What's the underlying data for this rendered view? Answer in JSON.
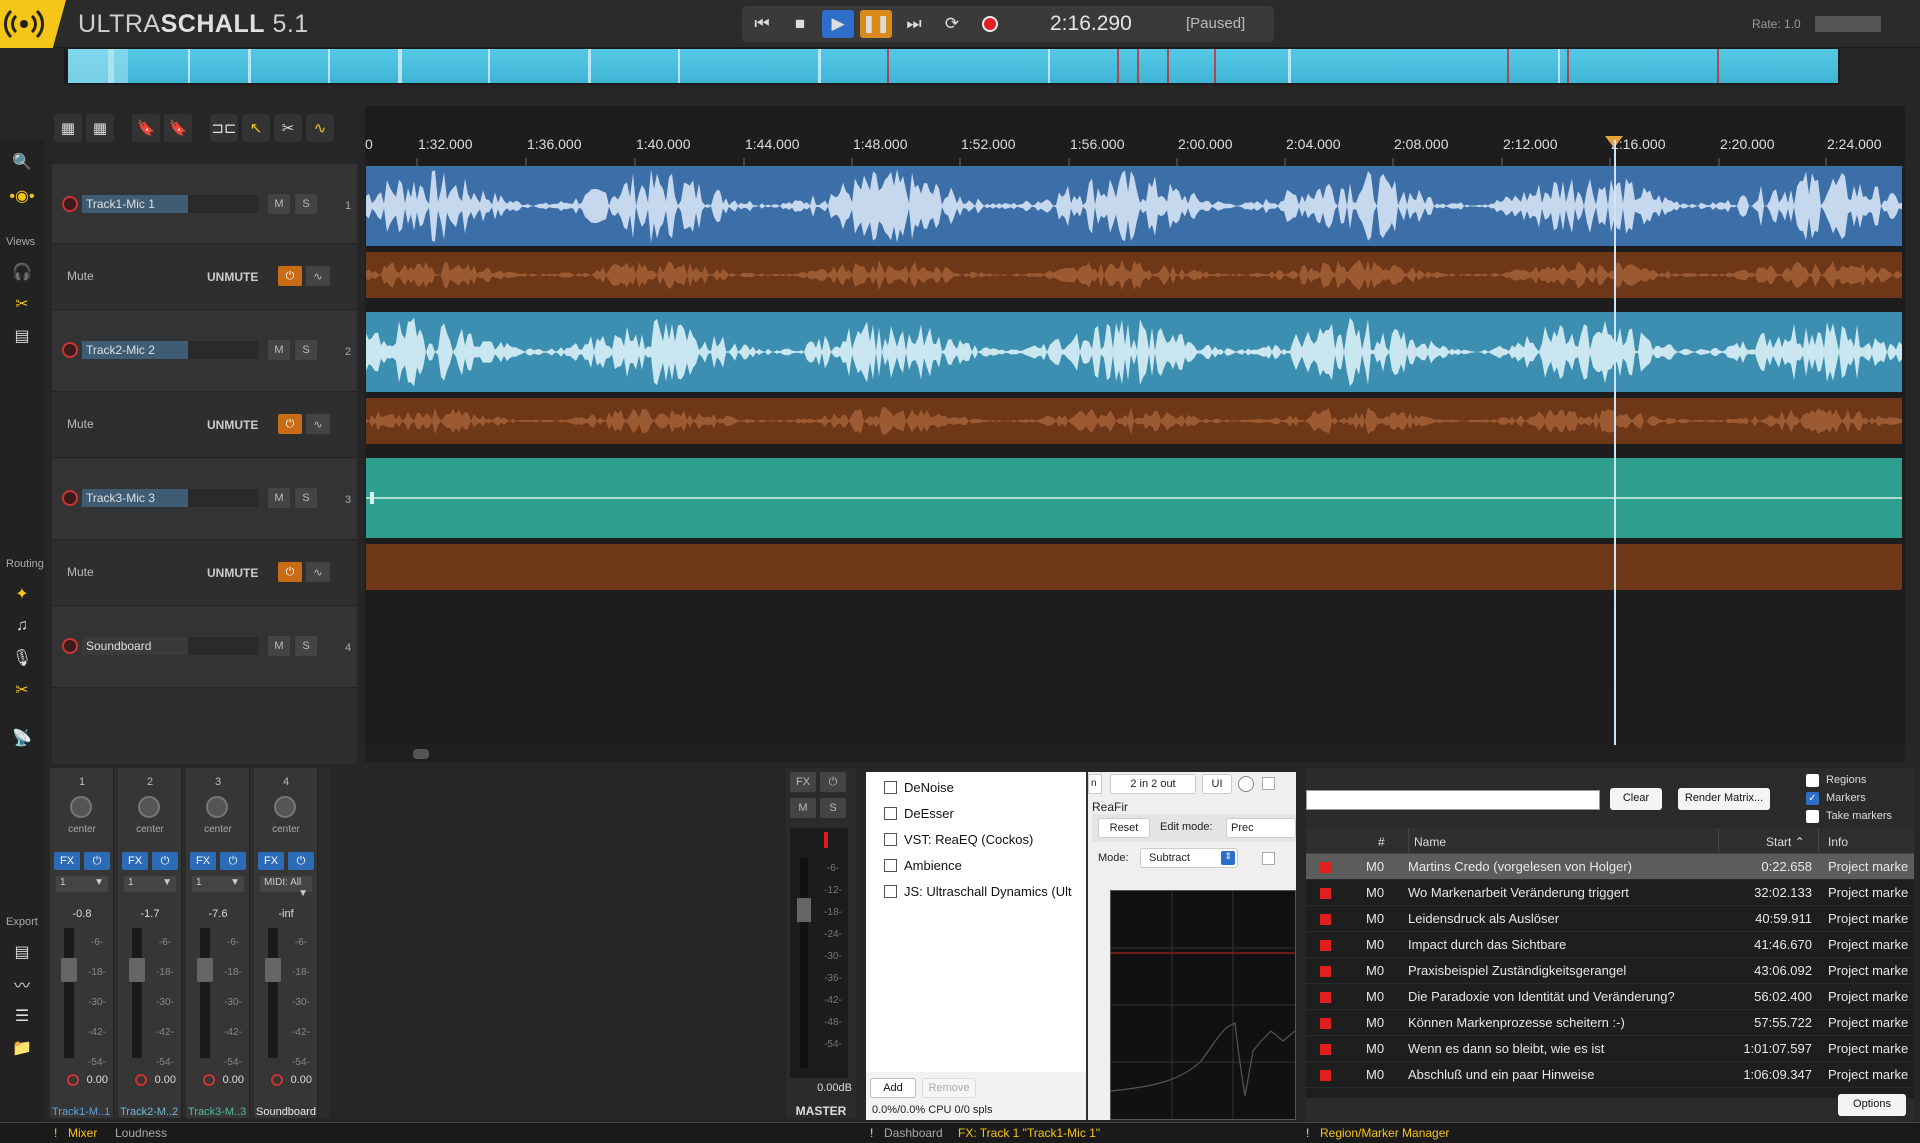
{
  "app": {
    "title_light": "ULTRA",
    "title_bold": "SCHALL",
    "version": "5.1"
  },
  "transport": {
    "time": "2:16.290",
    "status": "[Paused]",
    "rate_label": "Rate:",
    "rate_value": "1.0"
  },
  "ruler": [
    "1:32.000",
    "1:36.000",
    "1:40.000",
    "1:44.000",
    "1:48.000",
    "1:52.000",
    "1:56.000",
    "2:00.000",
    "2:04.000",
    "2:08.000",
    "2:12.000",
    "2:16.000",
    "2:20.000",
    "2:24.000"
  ],
  "ruler_prefix": "0",
  "leftbar": {
    "views_label": "Views",
    "routing_label": "Routing",
    "export_label": "Export"
  },
  "tracks": [
    {
      "name": "Track1-Mic 1",
      "m": "M",
      "s": "S",
      "num": "1",
      "env_label": "Mute",
      "env_state": "UNMUTE"
    },
    {
      "name": "Track2-Mic 2",
      "m": "M",
      "s": "S",
      "num": "2",
      "env_label": "Mute",
      "env_state": "UNMUTE"
    },
    {
      "name": "Track3-Mic 3",
      "m": "M",
      "s": "S",
      "num": "3",
      "env_label": "Mute",
      "env_state": "UNMUTE"
    },
    {
      "name": "Soundboard",
      "m": "M",
      "s": "S",
      "num": "4"
    }
  ],
  "mixer": {
    "strips": [
      {
        "num": "1",
        "pan": "center",
        "fx": "FX",
        "input": "1",
        "db": "-0.8",
        "vol": "0.00",
        "label": "Track1-M..1",
        "label_color": "#5aa0d8"
      },
      {
        "num": "2",
        "pan": "center",
        "fx": "FX",
        "input": "1",
        "db": "-1.7",
        "vol": "0.00",
        "label": "Track2-M..2",
        "label_color": "#6fb7d6"
      },
      {
        "num": "3",
        "pan": "center",
        "fx": "FX",
        "input": "1",
        "db": "-7.6",
        "vol": "0.00",
        "label": "Track3-M..3",
        "label_color": "#53b5a2"
      },
      {
        "num": "4",
        "pan": "center",
        "fx": "FX",
        "input": "MIDI: All",
        "db": "-inf",
        "vol": "0.00",
        "label": "Soundboard",
        "label_color": "#e8e8e8"
      }
    ],
    "scale": [
      "-6-",
      "-18-",
      "-30-",
      "-42-",
      "-54-"
    ],
    "master": {
      "fx": "FX",
      "m": "M",
      "s": "S",
      "db": "0.00dB",
      "label": "MASTER",
      "scale": [
        "-6-",
        "-12-",
        "-18-",
        "-24-",
        "-30-",
        "-36-",
        "-42-",
        "-48-",
        "-54-"
      ]
    }
  },
  "fx": {
    "items": [
      "DeNoise",
      "DeEsser",
      "VST: ReaEQ (Cockos)",
      "Ambience",
      "JS: Ultraschall Dynamics (Ult"
    ],
    "io": "2 in 2 out",
    "ui": "UI",
    "tab_partial": "n",
    "plugin_name": "ReaFir",
    "reset": "Reset",
    "edit_mode": "Edit mode:",
    "prec": "Prec",
    "mode_label": "Mode:",
    "mode_value": "Subtract",
    "add": "Add",
    "remove": "Remove",
    "cpu": "0.0%/0.0% CPU 0/0 spls"
  },
  "rm": {
    "clear": "Clear",
    "render": "Render Matrix...",
    "chk_regions": "Regions",
    "chk_markers": "Markers",
    "chk_take": "Take markers",
    "headers": {
      "num": "#",
      "name": "Name",
      "start": "Start",
      "info": "Info"
    },
    "rows": [
      {
        "id": "M0",
        "name": "Martins Credo (vorgelesen von Holger)",
        "start": "0:22.658",
        "info": "Project marke"
      },
      {
        "id": "M0",
        "name": "Wo Markenarbeit Veränderung triggert",
        "start": "32:02.133",
        "info": "Project marke"
      },
      {
        "id": "M0",
        "name": "Leidensdruck als Auslöser",
        "start": "40:59.911",
        "info": "Project marke"
      },
      {
        "id": "M0",
        "name": "Impact durch das Sichtbare",
        "start": "41:46.670",
        "info": "Project marke"
      },
      {
        "id": "M0",
        "name": "Praxisbeispiel Zuständigkeitsgerangel",
        "start": "43:06.092",
        "info": "Project marke"
      },
      {
        "id": "M0",
        "name": "Die Paradoxie von Identität und Veränderung?",
        "start": "56:02.400",
        "info": "Project marke"
      },
      {
        "id": "M0",
        "name": "Können Markenprozesse scheitern :-)",
        "start": "57:55.722",
        "info": "Project marke"
      },
      {
        "id": "M0",
        "name": "Wenn es dann so bleibt, wie es ist",
        "start": "1:01:07.597",
        "info": "Project marke"
      },
      {
        "id": "M0",
        "name": "Abschluß und ein paar Hinweise",
        "start": "1:06:09.347",
        "info": "Project marke"
      }
    ],
    "options": "Options"
  },
  "footer": {
    "mixer": "Mixer",
    "loudness": "Loudness",
    "dashboard": "Dashboard",
    "fx_tab": "FX: Track 1 \"Track1-Mic 1\"",
    "rm_tab": "Region/Marker Manager",
    "bang": "!"
  },
  "colors": {
    "accent": "#f5c518",
    "track1": "#3c6ea8",
    "track2": "#3c8fb0",
    "track3": "#2e9e8f",
    "env": "#7a3a1a",
    "marker": "#e21f1f"
  }
}
